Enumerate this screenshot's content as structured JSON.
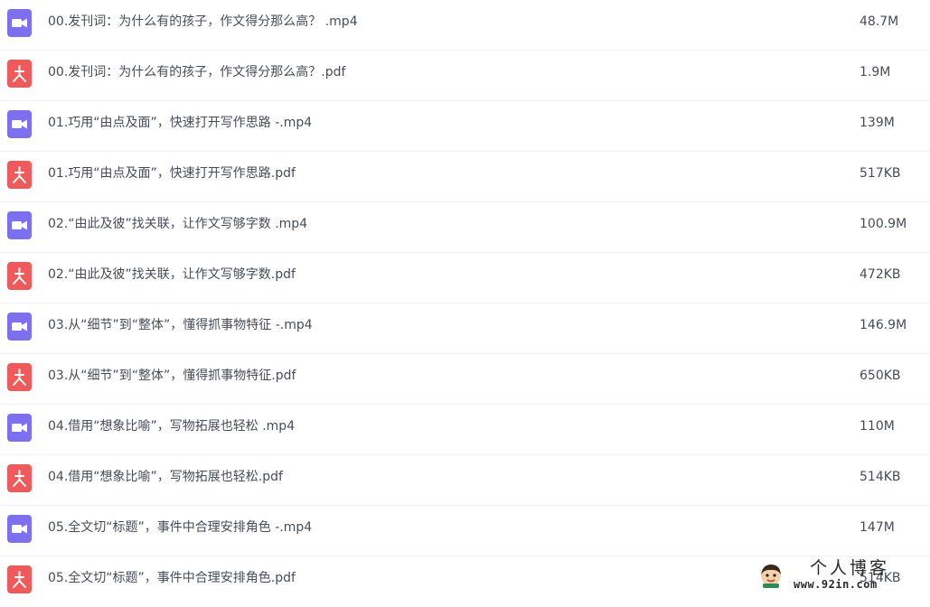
{
  "files": [
    {
      "type": "video",
      "icon": "video-icon",
      "name": "00.发刊词：为什么有的孩子，作文得分那么高？ .mp4",
      "size": "48.7M"
    },
    {
      "type": "pdf",
      "icon": "pdf-icon",
      "name": "00.发刊词：为什么有的孩子，作文得分那么高？.pdf",
      "size": "1.9M"
    },
    {
      "type": "video",
      "icon": "video-icon",
      "name": "01.巧用“由点及面”，快速打开写作思路 -.mp4",
      "size": "139M"
    },
    {
      "type": "pdf",
      "icon": "pdf-icon",
      "name": "01.巧用“由点及面”，快速打开写作思路.pdf",
      "size": "517KB"
    },
    {
      "type": "video",
      "icon": "video-icon",
      "name": "02.“由此及彼”找关联，让作文写够字数 .mp4",
      "size": "100.9M"
    },
    {
      "type": "pdf",
      "icon": "pdf-icon",
      "name": "02.“由此及彼”找关联，让作文写够字数.pdf",
      "size": "472KB"
    },
    {
      "type": "video",
      "icon": "video-icon",
      "name": "03.从“细节”到“整体”，懂得抓事物特征 -.mp4",
      "size": "146.9M"
    },
    {
      "type": "pdf",
      "icon": "pdf-icon",
      "name": "03.从“细节”到“整体”，懂得抓事物特征.pdf",
      "size": "650KB"
    },
    {
      "type": "video",
      "icon": "video-icon",
      "name": "04.借用“想象比喻”，写物拓展也轻松 .mp4",
      "size": "110M"
    },
    {
      "type": "pdf",
      "icon": "pdf-icon",
      "name": "04.借用“想象比喻”，写物拓展也轻松.pdf",
      "size": "514KB"
    },
    {
      "type": "video",
      "icon": "video-icon",
      "name": "05.全文切“标题”，事件中合理安排角色 -.mp4",
      "size": "147M"
    },
    {
      "type": "pdf",
      "icon": "pdf-icon",
      "name": "05.全文切“标题”，事件中合理安排角色.pdf",
      "size": "514KB"
    }
  ],
  "watermark": {
    "title": "个人博客",
    "url": "www.92in.com"
  },
  "colors": {
    "video_icon": "#7c6ff0",
    "pdf_icon": "#f05a5a",
    "text": "#454d5a",
    "row_divider": "#eef0f4"
  }
}
